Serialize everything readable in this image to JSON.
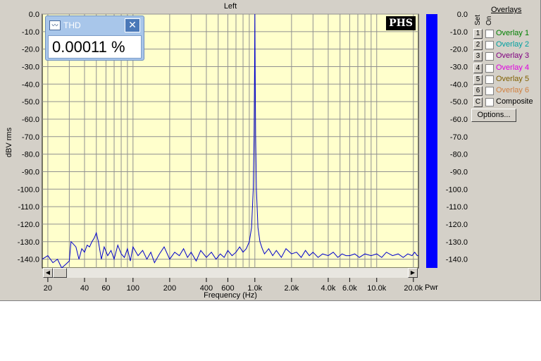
{
  "chart_data": {
    "type": "line",
    "title": "Left",
    "xlabel": "Frequency (Hz)",
    "ylabel": "dBV rms",
    "xscale": "log",
    "xlim": [
      18,
      22000
    ],
    "ylim": [
      -145,
      0
    ],
    "yticks": [
      "0.0",
      "-10.0",
      "-20.0",
      "-30.0",
      "-40.0",
      "-50.0",
      "-60.0",
      "-70.0",
      "-80.0",
      "-90.0",
      "-100.0",
      "-110.0",
      "-120.0",
      "-130.0",
      "-140.0"
    ],
    "xticks": [
      {
        "v": 20,
        "label": "20"
      },
      {
        "v": 40,
        "label": "40"
      },
      {
        "v": 60,
        "label": "60"
      },
      {
        "v": 100,
        "label": "100"
      },
      {
        "v": 200,
        "label": "200"
      },
      {
        "v": 400,
        "label": "400"
      },
      {
        "v": 600,
        "label": "600"
      },
      {
        "v": 1000,
        "label": "1.0k"
      },
      {
        "v": 2000,
        "label": "2.0k"
      },
      {
        "v": 4000,
        "label": "4.0k"
      },
      {
        "v": 6000,
        "label": "6.0k"
      },
      {
        "v": 10000,
        "label": "10.0k"
      },
      {
        "v": 20000,
        "label": "20.0k"
      }
    ],
    "grid": true,
    "plot_bg": "#ffffcc",
    "line_color": "#0000cc",
    "series": [
      {
        "points": [
          [
            18,
            -140
          ],
          [
            20,
            -138
          ],
          [
            22,
            -142
          ],
          [
            24,
            -140
          ],
          [
            26,
            -145
          ],
          [
            28,
            -143
          ],
          [
            30,
            -141
          ],
          [
            31,
            -130
          ],
          [
            32,
            -131
          ],
          [
            34,
            -133
          ],
          [
            36,
            -140
          ],
          [
            38,
            -134
          ],
          [
            40,
            -136
          ],
          [
            42,
            -132
          ],
          [
            44,
            -133
          ],
          [
            46,
            -130
          ],
          [
            48,
            -128
          ],
          [
            50,
            -125
          ],
          [
            52,
            -130
          ],
          [
            55,
            -140
          ],
          [
            58,
            -133
          ],
          [
            62,
            -138
          ],
          [
            66,
            -135
          ],
          [
            70,
            -140
          ],
          [
            75,
            -132
          ],
          [
            80,
            -137
          ],
          [
            85,
            -139
          ],
          [
            90,
            -134
          ],
          [
            95,
            -141
          ],
          [
            100,
            -133
          ],
          [
            110,
            -138
          ],
          [
            120,
            -135
          ],
          [
            130,
            -140
          ],
          [
            140,
            -136
          ],
          [
            150,
            -142
          ],
          [
            165,
            -137
          ],
          [
            180,
            -133
          ],
          [
            200,
            -140
          ],
          [
            220,
            -136
          ],
          [
            240,
            -138
          ],
          [
            260,
            -134
          ],
          [
            280,
            -139
          ],
          [
            300,
            -136
          ],
          [
            330,
            -141
          ],
          [
            360,
            -135
          ],
          [
            400,
            -139
          ],
          [
            440,
            -136
          ],
          [
            480,
            -140
          ],
          [
            520,
            -137
          ],
          [
            560,
            -139
          ],
          [
            600,
            -135
          ],
          [
            650,
            -138
          ],
          [
            700,
            -136
          ],
          [
            750,
            -133
          ],
          [
            800,
            -136
          ],
          [
            850,
            -134
          ],
          [
            900,
            -130
          ],
          [
            940,
            -122
          ],
          [
            970,
            -100
          ],
          [
            985,
            -70
          ],
          [
            995,
            -30
          ],
          [
            1000,
            0
          ],
          [
            1005,
            -30
          ],
          [
            1015,
            -70
          ],
          [
            1030,
            -100
          ],
          [
            1060,
            -122
          ],
          [
            1100,
            -130
          ],
          [
            1150,
            -134
          ],
          [
            1200,
            -137
          ],
          [
            1300,
            -134
          ],
          [
            1400,
            -138
          ],
          [
            1500,
            -135
          ],
          [
            1650,
            -139
          ],
          [
            1800,
            -134
          ],
          [
            2000,
            -137
          ],
          [
            2200,
            -136
          ],
          [
            2400,
            -139
          ],
          [
            2600,
            -135
          ],
          [
            2800,
            -138
          ],
          [
            3000,
            -136
          ],
          [
            3300,
            -139
          ],
          [
            3600,
            -137
          ],
          [
            4000,
            -138
          ],
          [
            4400,
            -136
          ],
          [
            4800,
            -139
          ],
          [
            5200,
            -137
          ],
          [
            5600,
            -138
          ],
          [
            6000,
            -138
          ],
          [
            6600,
            -137
          ],
          [
            7200,
            -139
          ],
          [
            8000,
            -137
          ],
          [
            9000,
            -138
          ],
          [
            10000,
            -137
          ],
          [
            11000,
            -139
          ],
          [
            12000,
            -136
          ],
          [
            13500,
            -138
          ],
          [
            15000,
            -137
          ],
          [
            16500,
            -139
          ],
          [
            18000,
            -137
          ],
          [
            19500,
            -138
          ],
          [
            20500,
            -136
          ],
          [
            21500,
            -138
          ],
          [
            22000,
            -138
          ]
        ]
      }
    ]
  },
  "thd": {
    "title": "THD",
    "value": "0.00011 %"
  },
  "logo": "PHS",
  "power": {
    "label": "Pwr",
    "ticks": [
      "0.0",
      "-10.0",
      "-20.0",
      "-30.0",
      "-40.0",
      "-50.0",
      "-60.0",
      "-70.0",
      "-80.0",
      "-90.0",
      "-100.0",
      "-110.0",
      "-120.0",
      "-130.0",
      "-140.0"
    ]
  },
  "overlays": {
    "title": "Overlays",
    "set_label": "Set",
    "on_label": "On",
    "items": [
      {
        "btn": "1",
        "label": "Overlay 1",
        "color": "#008000"
      },
      {
        "btn": "2",
        "label": "Overlay 2",
        "color": "#00a0a0"
      },
      {
        "btn": "3",
        "label": "Overlay 3",
        "color": "#800080"
      },
      {
        "btn": "4",
        "label": "Overlay 4",
        "color": "#e000e0"
      },
      {
        "btn": "5",
        "label": "Overlay 5",
        "color": "#806000"
      },
      {
        "btn": "6",
        "label": "Overlay 6",
        "color": "#d08040"
      },
      {
        "btn": "C",
        "label": "Composite",
        "color": "#000000"
      }
    ],
    "options_label": "Options..."
  },
  "scroll": {
    "left_glyph": "◀",
    "right_glyph": "▶"
  }
}
